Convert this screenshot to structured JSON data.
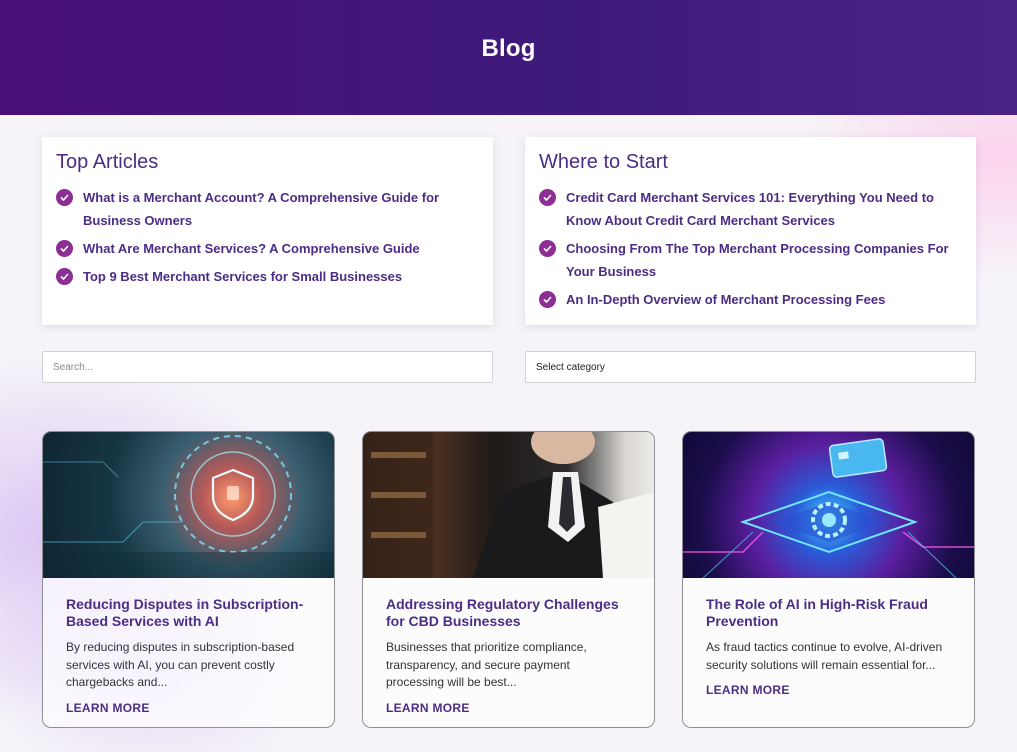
{
  "header": {
    "title": "Blog"
  },
  "top_articles": {
    "title": "Top Articles",
    "items": [
      "What is a Merchant Account? A Comprehensive Guide for Business Owners",
      "What Are Merchant Services? A Comprehensive Guide",
      "Top 9 Best Merchant Services for Small Businesses"
    ]
  },
  "where_to_start": {
    "title": "Where to Start",
    "items": [
      "Credit Card Merchant Services 101: Everything You Need to Know About Credit Card Merchant Services",
      "Choosing From The Top Merchant Processing Companies For Your Business",
      "An In-Depth Overview of Merchant Processing Fees"
    ]
  },
  "search": {
    "placeholder": "Search..."
  },
  "category_select": {
    "selected": "Select category"
  },
  "posts": [
    {
      "title": "Reducing Disputes in Subscription-Based Services with AI",
      "excerpt": "By reducing disputes in subscription-based services with AI, you can prevent costly chargebacks and...",
      "link": "LEARN MORE"
    },
    {
      "title": "Addressing Regulatory Challenges for CBD Businesses",
      "excerpt": "Businesses that prioritize compliance, transparency, and secure payment processing will be best...",
      "link": "LEARN MORE"
    },
    {
      "title": "The Role of AI in High-Risk Fraud Prevention",
      "excerpt": "As fraud tactics continue to evolve, AI-driven security solutions will remain essential for...",
      "link": "LEARN MORE"
    }
  ],
  "colors": {
    "header_bg": "#451a7c",
    "accent": "#4b2d86",
    "check": "#8c2e94"
  }
}
